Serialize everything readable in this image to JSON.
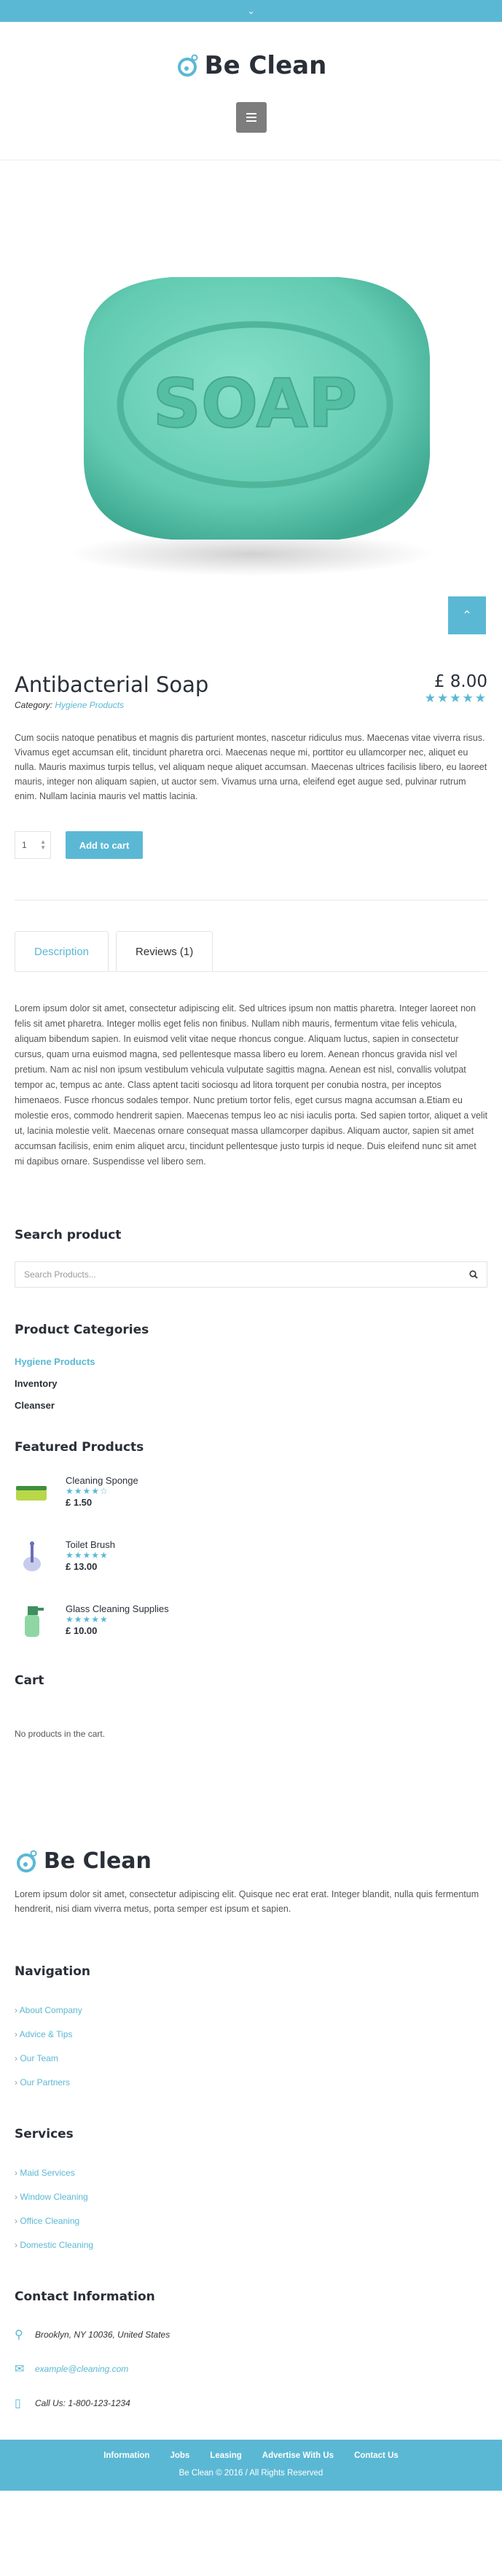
{
  "topbar": {
    "icon": "chevron-down"
  },
  "brand": {
    "name": "Be Clean"
  },
  "product": {
    "title": "Antibacterial Soap",
    "price": "£ 8.00",
    "rating": 5,
    "category_label": "Category:",
    "category": "Hygiene Products",
    "description": "Cum sociis natoque penatibus et magnis dis parturient montes, nascetur ridiculus mus. Maecenas vitae viverra risus. Vivamus eget accumsan elit, tincidunt pharetra orci. Maecenas neque mi, porttitor eu ullamcorper nec, aliquet eu nulla. Mauris maximus turpis tellus, vel aliquam neque aliquet accumsan. Maecenas ultrices facilisis libero, eu laoreet mauris, integer non aliquam sapien, ut auctor sem. Vivamus urna urna, eleifend eget augue sed, pulvinar rutrum enim. Nullam lacinia mauris vel mattis lacinia.",
    "quantity": "1",
    "add_to_cart": "Add to cart",
    "image_text": "SOAP"
  },
  "tabs": [
    {
      "label": "Description"
    },
    {
      "label": "Reviews (1)"
    }
  ],
  "tab_body": "Lorem ipsum dolor sit amet, consectetur adipiscing elit. Sed ultrices ipsum non mattis pharetra. Integer laoreet non felis sit amet pharetra. Integer mollis eget felis non finibus. Nullam nibh mauris, fermentum vitae felis vehicula, aliquam bibendum sapien. In euismod velit vitae neque rhoncus congue. Aliquam luctus, sapien in consectetur cursus, quam urna euismod magna, sed pellentesque massa libero eu lorem. Aenean rhoncus gravida nisl vel pretium. Nam ac nisl non ipsum vestibulum vehicula vulputate sagittis magna. Aenean est nisl, convallis volutpat tempor ac, tempus ac ante. Class aptent taciti sociosqu ad litora torquent per conubia nostra, per inceptos himenaeos. Fusce rhoncus sodales tempor. Nunc pretium tortor felis, eget cursus magna accumsan a.Etiam eu molestie eros, commodo hendrerit sapien. Maecenas tempus leo ac nisi iaculis porta. Sed sapien tortor, aliquet a velit ut, lacinia molestie velit. Maecenas ornare consequat massa ullamcorper dapibus. Aliquam auctor, sapien sit amet accumsan facilisis, enim enim aliquet arcu, tincidunt pellentesque justo turpis id neque. Duis eleifend nunc sit amet mi dapibus ornare. Suspendisse vel libero sem.",
  "search": {
    "title": "Search product",
    "placeholder": "Search Products..."
  },
  "categories": {
    "title": "Product Categories",
    "items": [
      "Hygiene Products",
      "Inventory",
      "Cleanser"
    ]
  },
  "featured": {
    "title": "Featured Products",
    "items": [
      {
        "name": "Cleaning Sponge",
        "rating": 3.5,
        "price": "£ 1.50",
        "color": "#b8d84a"
      },
      {
        "name": "Toilet Brush",
        "rating": 5,
        "price": "£ 13.00",
        "color": "#9aa0d8"
      },
      {
        "name": "Glass Cleaning Supplies",
        "rating": 5,
        "price": "£ 10.00",
        "color": "#8fd6a3"
      }
    ]
  },
  "cart": {
    "title": "Cart",
    "empty": "No products in the cart."
  },
  "footer": {
    "about": "Lorem ipsum dolor sit amet, consectetur adipiscing elit. Quisque nec erat erat. Integer blandit, nulla quis fermentum hendrerit, nisi diam viverra metus, porta semper est ipsum et sapien.",
    "navigation": {
      "title": "Navigation",
      "items": [
        "About Company",
        "Advice & Tips",
        "Our Team",
        "Our Partners"
      ]
    },
    "services": {
      "title": "Services",
      "items": [
        "Maid Services",
        "Window Cleaning",
        "Office Cleaning",
        "Domestic Cleaning"
      ]
    },
    "contact": {
      "title": "Contact Information",
      "address": "Brooklyn, NY 10036, United States",
      "email": "example@cleaning.com",
      "phone": "Call Us: 1-800-123-1234"
    },
    "bottom_links": [
      "Information",
      "Jobs",
      "Leasing",
      "Advertise With Us",
      "Contact Us"
    ],
    "copyright": "Be Clean © 2016 / All Rights Reserved"
  },
  "colors": {
    "accent": "#5bb8d4",
    "dark": "#2a2f38",
    "soap": "#6cd3bb"
  }
}
